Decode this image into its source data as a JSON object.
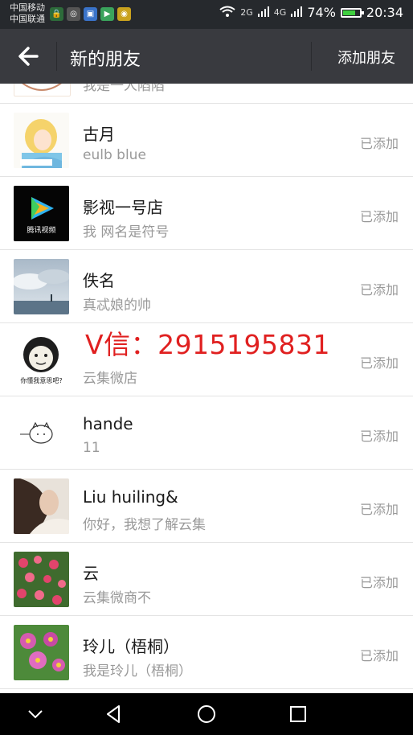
{
  "status_bar": {
    "carrier1": "中国移动",
    "carrier2": "中国联通",
    "signal1": "2G",
    "signal2": "4G",
    "battery": "74%",
    "battery_level": 0.74,
    "time": "20:34"
  },
  "header": {
    "title": "新的朋友",
    "action": "添加朋友"
  },
  "partial_row": {
    "sub": "我是一人陷陷"
  },
  "contacts": [
    {
      "name": "古月",
      "sub": "eulb blue",
      "status": "已添加"
    },
    {
      "name": "影视一号店",
      "sub": "我 网名是符号",
      "status": "已添加"
    },
    {
      "name": "佚名",
      "sub": "真忒娘的帅",
      "status": "已添加"
    },
    {
      "name": "",
      "sub": "云集微店",
      "status": "已添加"
    },
    {
      "name": "hande",
      "sub": "11",
      "status": "已添加"
    },
    {
      "name": "Liu huiling&",
      "sub": "你好，我想了解云集",
      "status": "已添加"
    },
    {
      "name": "云",
      "sub": "云集微商不",
      "status": "已添加"
    },
    {
      "name": "玲儿（梧桐）",
      "sub": "我是玲儿（梧桐）",
      "status": "已添加"
    }
  ],
  "overlay_text": "V信：2915195831",
  "avatar_captions": {
    "video_logo": "腾讯视频",
    "meme_caption": "你懂我意思吧?"
  },
  "colors": {
    "header_bg": "#393a3f",
    "status_bg": "#26292d",
    "overlay_red": "#e02020"
  }
}
